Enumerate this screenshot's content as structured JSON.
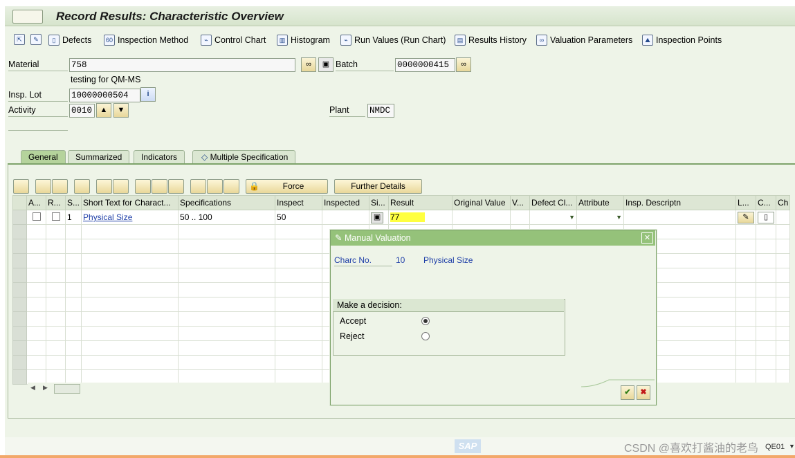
{
  "window": {
    "title": "Record Results: Characteristic Overview"
  },
  "toolbar": {
    "items": [
      {
        "label": "Defects",
        "icon": "document-icon"
      },
      {
        "label": "Inspection Method",
        "icon": "method-icon"
      },
      {
        "label": "Control Chart",
        "icon": "chart-icon"
      },
      {
        "label": "Histogram",
        "icon": "histogram-icon"
      },
      {
        "label": "Run Values (Run Chart)",
        "icon": "run-chart-icon"
      },
      {
        "label": "Results History",
        "icon": "history-icon"
      },
      {
        "label": "Valuation Parameters",
        "icon": "glasses-icon"
      },
      {
        "label": "Inspection Points",
        "icon": "points-icon"
      }
    ]
  },
  "header": {
    "material_label": "Material",
    "material_value": "758",
    "material_desc": "testing for QM-MS",
    "batch_label": "Batch",
    "batch_value": "0000000415",
    "lot_label": "Insp. Lot",
    "lot_value": "10000000504",
    "activity_label": "Activity",
    "activity_value": "0010",
    "plant_label": "Plant",
    "plant_value": "NMDC"
  },
  "tabs": [
    {
      "label": "General",
      "active": true
    },
    {
      "label": "Summarized",
      "active": false
    },
    {
      "label": "Indicators",
      "active": false
    },
    {
      "label": "Multiple Specification",
      "active": false
    }
  ],
  "grid_toolbar": {
    "force_label": "Force",
    "further_label": "Further Details"
  },
  "grid": {
    "columns": [
      "A...",
      "R...",
      "S...",
      "Short Text for Charact...",
      "Specifications",
      "Inspect",
      "Inspected",
      "Si...",
      "Result",
      "Original Value",
      "V...",
      "Defect Cl...",
      "Attribute",
      "Insp. Descriptn",
      "L...",
      "C...",
      "Ch"
    ],
    "rows": [
      {
        "seq": "1",
        "short_text": "Physical Size",
        "spec": "50 .. 100",
        "inspect": "50",
        "result": "77"
      }
    ]
  },
  "dialog": {
    "title": "Manual Valuation",
    "charc_label": "Charc No.",
    "charc_no": "10",
    "charc_name": "Physical Size",
    "group_title": "Make a decision:",
    "options": [
      {
        "label": "Accept",
        "selected": true
      },
      {
        "label": "Reject",
        "selected": false
      }
    ]
  },
  "footer": {
    "sap_logo": "SAP",
    "watermark": "CSDN @喜欢打酱油的老鸟",
    "system": "QE01"
  },
  "colors": {
    "accent_green": "#95c27a",
    "result_highlight": "#ffff40",
    "link_blue": "#1f3fa8"
  }
}
